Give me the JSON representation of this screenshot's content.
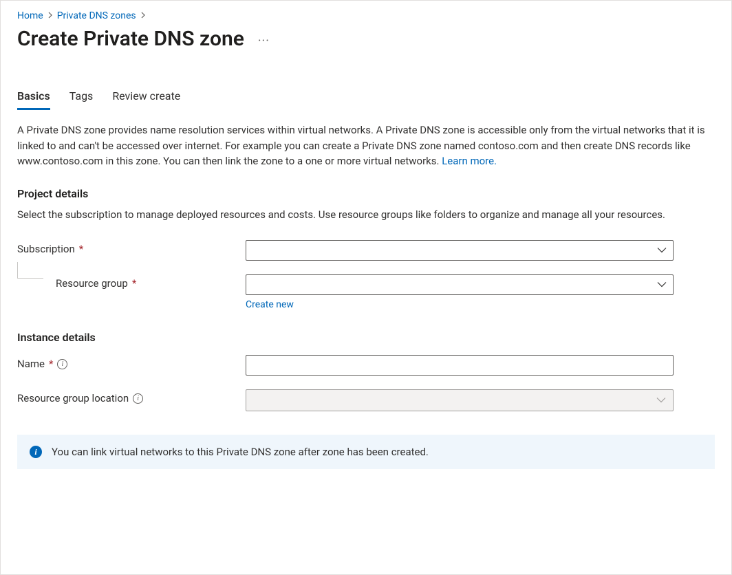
{
  "breadcrumb": {
    "home": "Home",
    "zones": "Private DNS zones"
  },
  "pageTitle": "Create Private DNS zone",
  "tabs": {
    "basics": "Basics",
    "tags": "Tags",
    "review": "Review create"
  },
  "description": "A Private DNS zone provides name resolution services within virtual networks. A Private DNS zone is accessible only from the virtual networks that it is linked to and can't be accessed over internet. For example you can create a Private DNS zone named contoso.com and then create DNS records like www.contoso.com in this zone. You can then link the zone to a one or more virtual networks.  ",
  "learnMore": "Learn more.",
  "projectDetails": {
    "heading": "Project details",
    "sub": "Select the subscription to manage deployed resources and costs. Use resource groups like folders to organize and manage all your resources.",
    "subscriptionLabel": "Subscription",
    "subscriptionValue": "",
    "resourceGroupLabel": "Resource group",
    "resourceGroupValue": "",
    "createNew": "Create new"
  },
  "instanceDetails": {
    "heading": "Instance details",
    "nameLabel": "Name",
    "nameValue": "",
    "locationLabel": "Resource group location",
    "locationValue": ""
  },
  "banner": "You can link virtual networks to this Private DNS zone after zone has been created."
}
